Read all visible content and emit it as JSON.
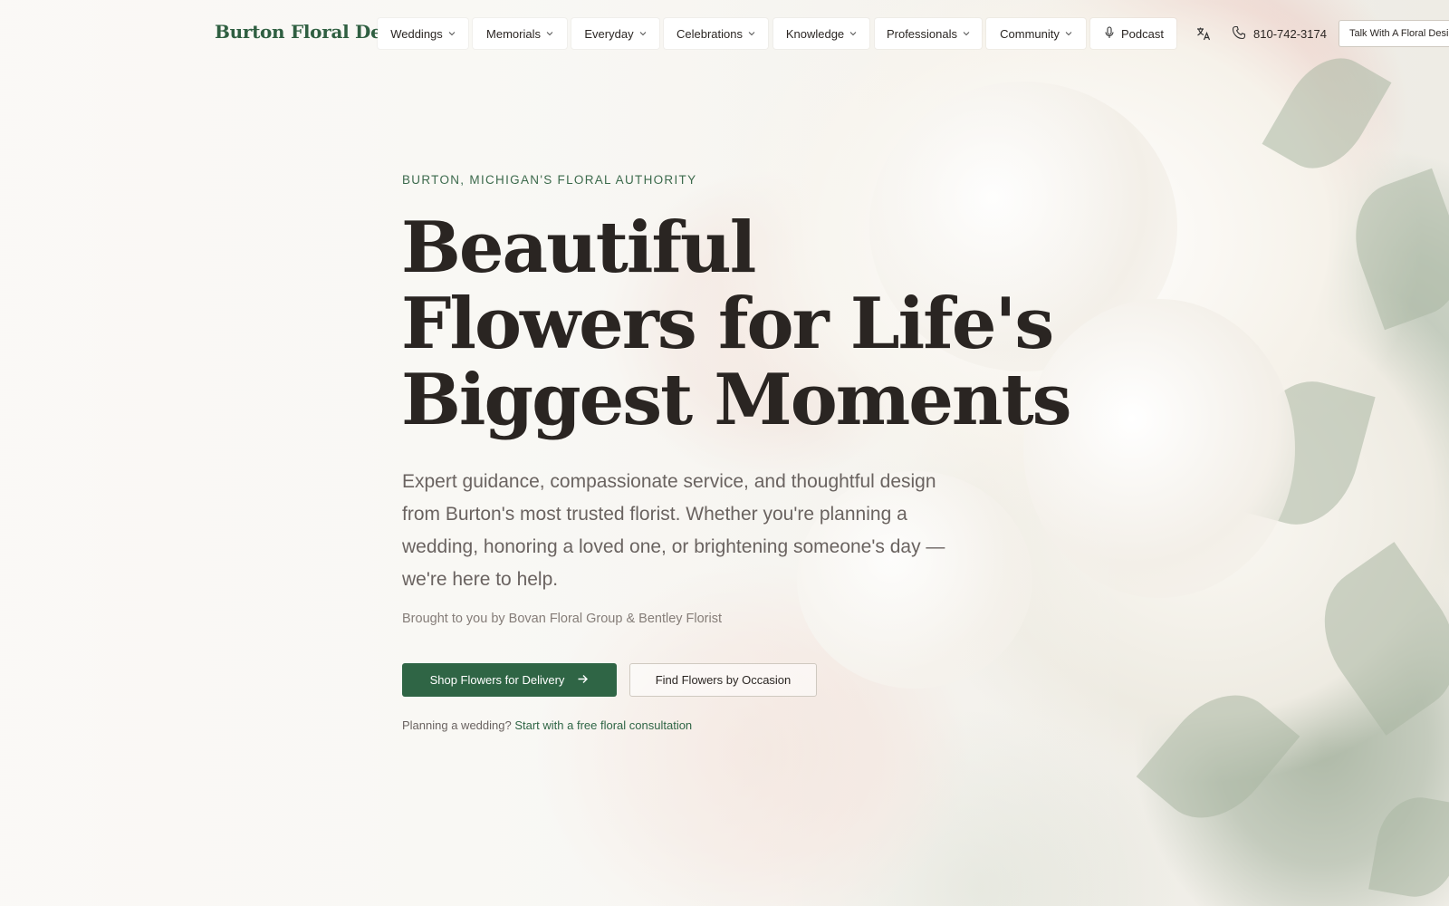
{
  "header": {
    "brand": "Burton Floral Design",
    "nav": [
      {
        "label": "Weddings",
        "has_dropdown": true
      },
      {
        "label": "Memorials",
        "has_dropdown": true
      },
      {
        "label": "Everyday",
        "has_dropdown": true
      },
      {
        "label": "Celebrations",
        "has_dropdown": true
      },
      {
        "label": "Knowledge",
        "has_dropdown": true
      },
      {
        "label": "Professionals",
        "has_dropdown": true
      },
      {
        "label": "Community",
        "has_dropdown": true
      },
      {
        "label": "Podcast",
        "has_dropdown": false,
        "icon": "microphone-icon"
      }
    ],
    "translate_icon": "translate-icon",
    "phone_icon": "phone-icon",
    "phone": "810-742-3174",
    "talk_button": "Talk With A Floral Desi"
  },
  "hero": {
    "eyebrow": "Burton, Michigan's Floral Authority",
    "headline_line1": "Beautiful",
    "headline_line2": "Flowers for Life's",
    "headline_line3": "Biggest Moments",
    "lede": "Expert guidance, compassionate service, and thoughtful design from Burton's most trusted florist. Whether you're planning a wedding, honoring a loved one, or brightening someone's day — we're here to help.",
    "attribution": "Brought to you by Bovan Floral Group & Bentley Florist",
    "primary_cta": "Shop Flowers for Delivery",
    "primary_cta_icon": "arrow-right-icon",
    "secondary_cta": "Find Flowers by Occasion",
    "planning_prefix": "Planning a wedding?",
    "planning_link": "Start with a free floral consultation"
  },
  "colors": {
    "brand_green": "#2f6545",
    "brand_text_green": "#2f5f41",
    "headline": "#2a2522",
    "body_text": "#6a6360",
    "page_background": "#f7f5f1"
  }
}
